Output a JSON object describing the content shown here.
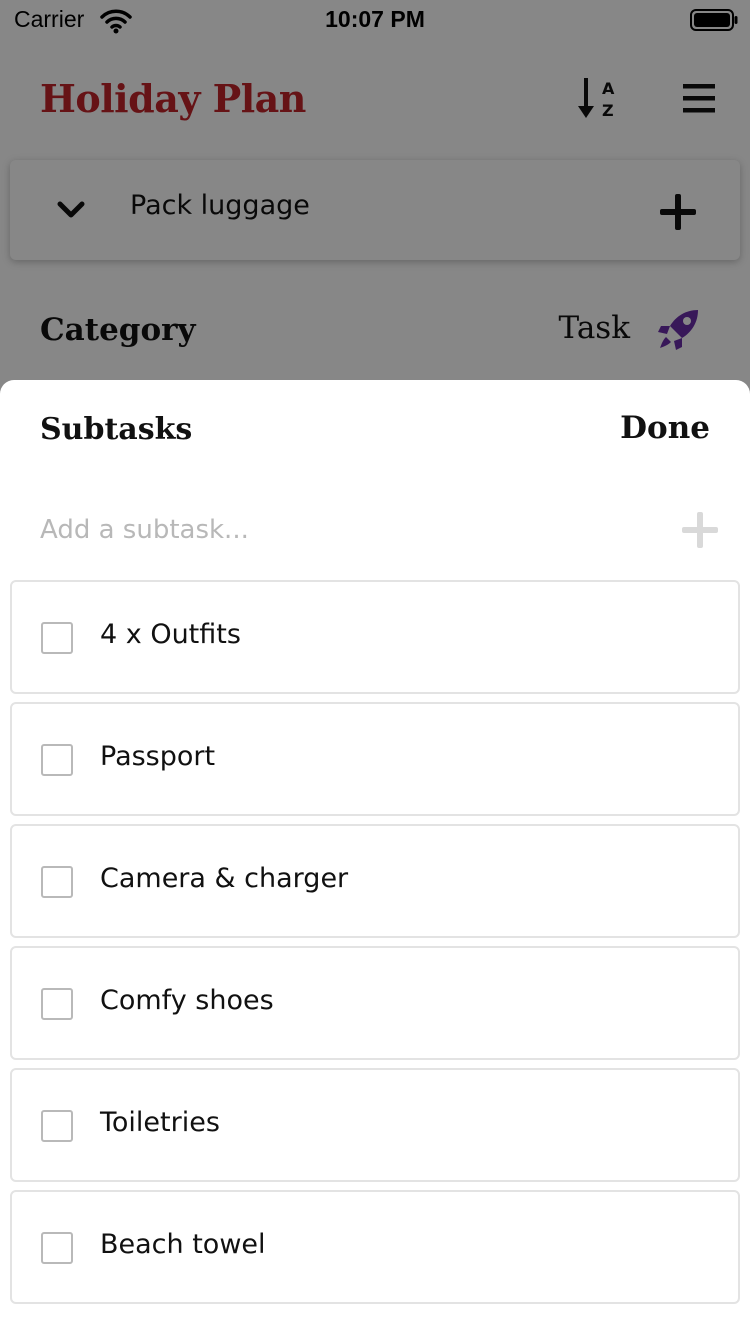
{
  "status_bar": {
    "carrier": "Carrier",
    "time": "10:07 PM"
  },
  "header": {
    "title": "Holiday Plan",
    "title_color": "#c0242b",
    "sort_icon": "sort-alpha-down-icon",
    "menu_icon": "hamburger-menu-icon"
  },
  "task": {
    "title": "Pack luggage",
    "expand_icon": "chevron-down-icon",
    "add_icon": "plus-icon"
  },
  "category": {
    "label": "Category",
    "value": "Task",
    "icon": "rocket-icon",
    "icon_color": "#6b2fa8"
  },
  "sheet": {
    "title": "Subtasks",
    "done_label": "Done",
    "input_placeholder": "Add a subtask...",
    "input_value": "",
    "add_icon": "plus-icon"
  },
  "subtasks": [
    {
      "label": "4 x Outfits",
      "checked": false
    },
    {
      "label": "Passport",
      "checked": false
    },
    {
      "label": "Camera & charger",
      "checked": false
    },
    {
      "label": "Comfy shoes",
      "checked": false
    },
    {
      "label": "Toiletries",
      "checked": false
    },
    {
      "label": "Beach towel",
      "checked": false
    }
  ]
}
